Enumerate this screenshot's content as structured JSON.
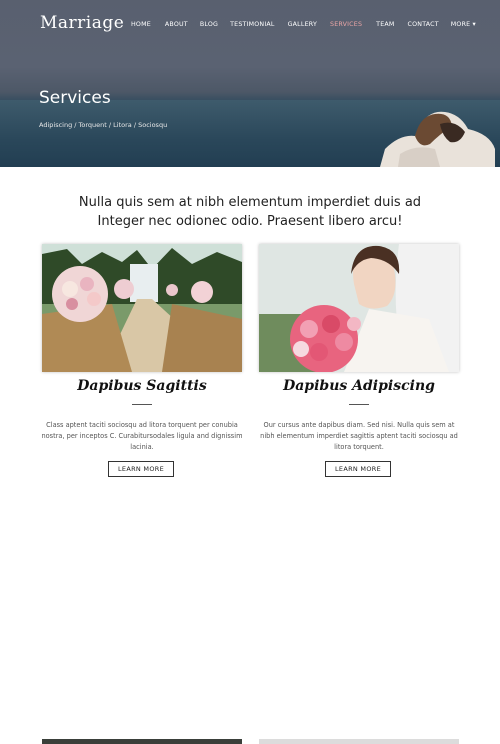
{
  "brand": "Marriage",
  "nav": {
    "items": [
      {
        "label": "HOME"
      },
      {
        "label": "ABOUT"
      },
      {
        "label": "BLOG"
      },
      {
        "label": "TESTIMONIAL"
      },
      {
        "label": "GALLERY"
      },
      {
        "label": "SERVICES"
      },
      {
        "label": "TEAM"
      },
      {
        "label": "CONTACT"
      },
      {
        "label": "MORE ▾"
      }
    ],
    "active_color": "#e9a5a5"
  },
  "hero": {
    "title": "Services",
    "breadcrumb": "Adipiscing / Torquent / Litora / Sociosqu"
  },
  "intro": {
    "line1": "Nulla quis sem at nibh elementum imperdiet duis ad",
    "line2": "Integer nec odionec odio. Praesent libero arcu!"
  },
  "cards": [
    {
      "title": "Dapibus Sagittis",
      "text": "Class aptent taciti sociosqu ad litora torquent per conubia nostra, per inceptos C. Curabitursodales ligula and dignissim lacinia.",
      "button": "LEARN MORE"
    },
    {
      "title": "Dapibus Adipiscing",
      "text": "Our cursus ante dapibus diam. Sed nisi. Nulla quis sem at nibh elementum imperdiet sagittis aptent taciti sociosqu ad litora torquent.",
      "button": "LEARN MORE"
    }
  ]
}
